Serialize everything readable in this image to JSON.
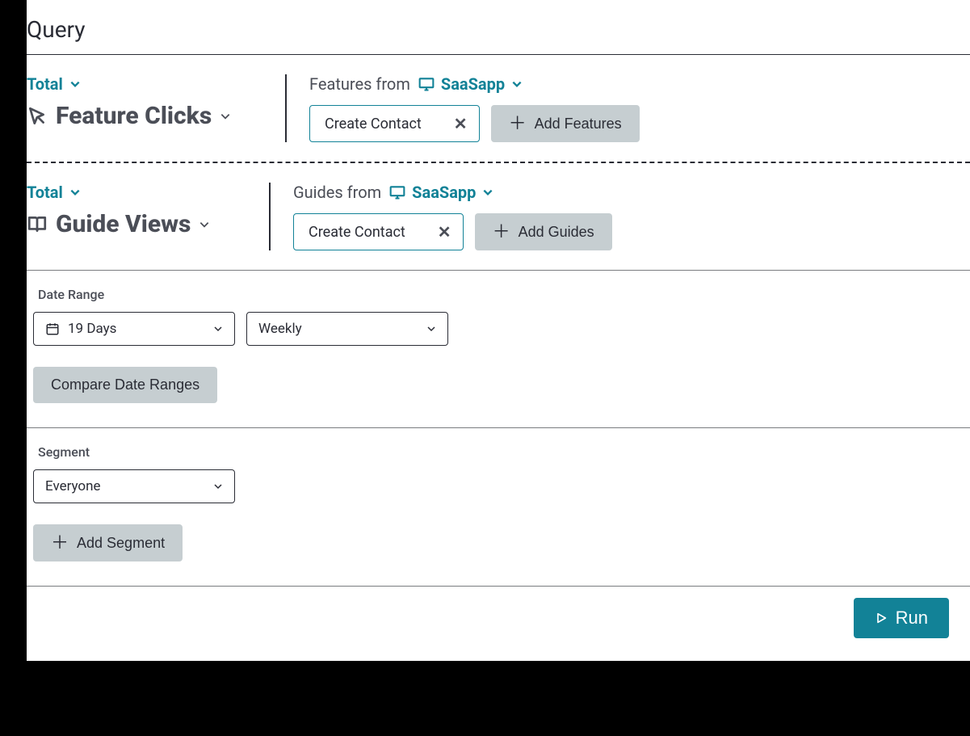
{
  "heading": "Query",
  "rows": [
    {
      "total_label": "Total",
      "metric": "Feature Clicks",
      "from_prefix": "Features from",
      "app_name": "SaaSapp",
      "chip": "Create Contact",
      "add_btn": "Add Features"
    },
    {
      "total_label": "Total",
      "metric": "Guide Views",
      "from_prefix": "Guides from",
      "app_name": "SaaSapp",
      "chip": "Create Contact",
      "add_btn": "Add Guides"
    }
  ],
  "date_range": {
    "label": "Date Range",
    "value": "19 Days",
    "granularity": "Weekly",
    "compare_btn": "Compare Date Ranges"
  },
  "segment": {
    "label": "Segment",
    "value": "Everyone",
    "add_btn": "Add Segment"
  },
  "run_label": "Run"
}
